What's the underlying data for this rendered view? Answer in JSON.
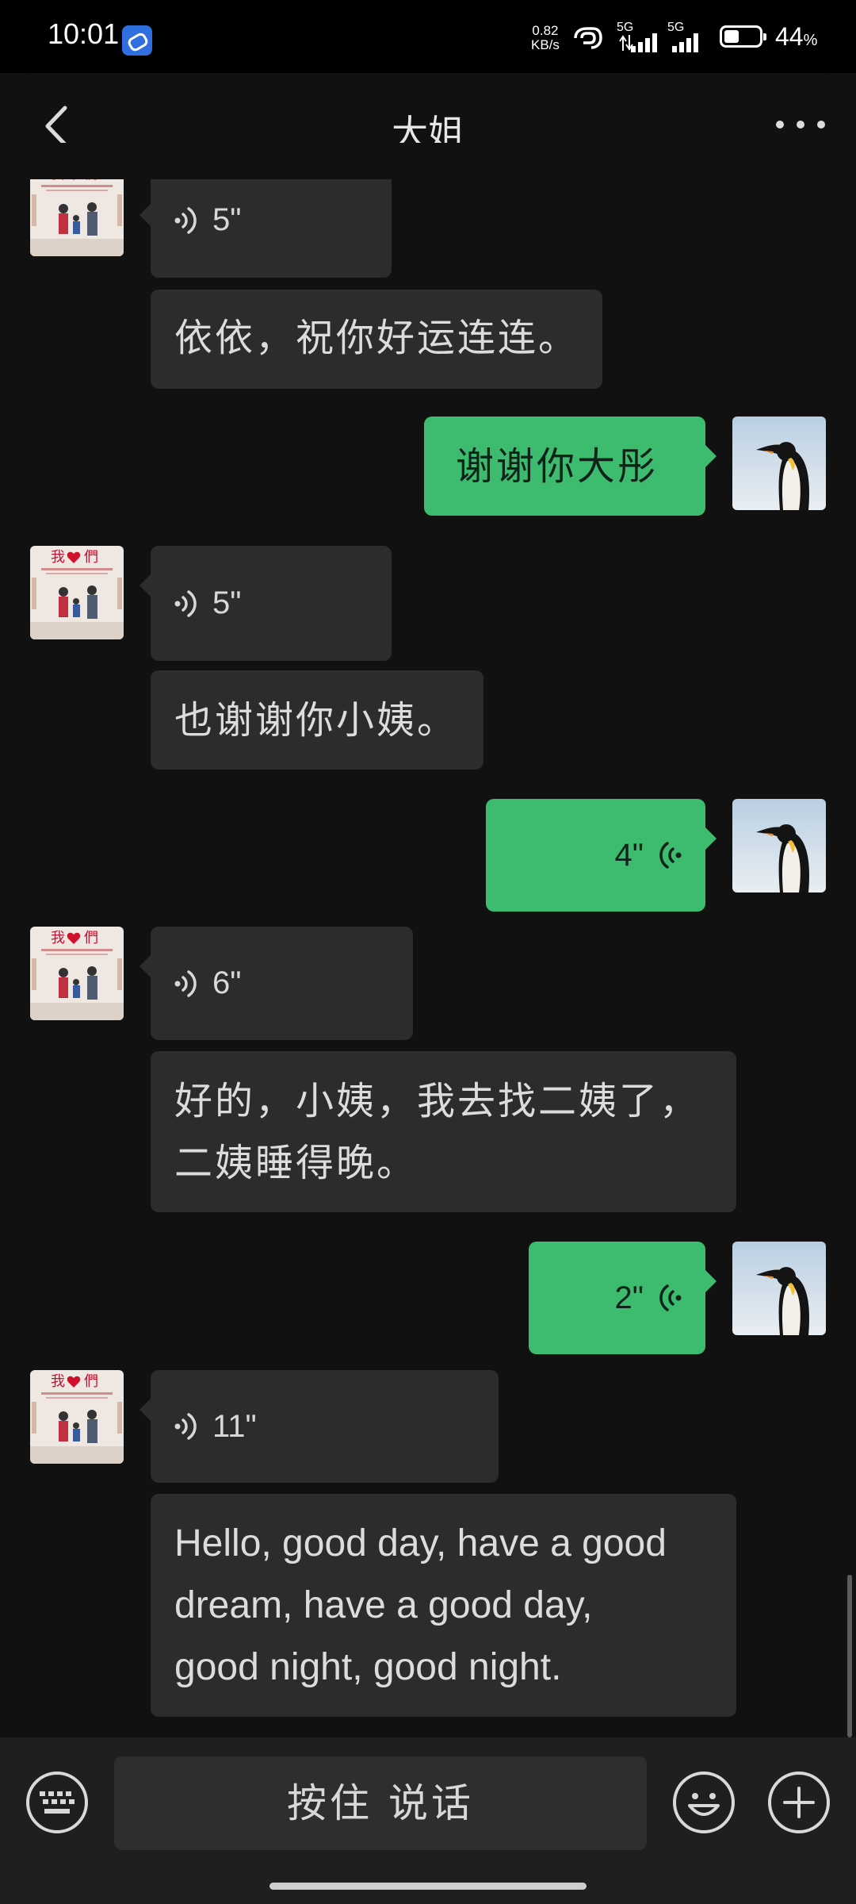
{
  "status_bar": {
    "time": "10:01",
    "net_speed_value": "0.82",
    "net_speed_unit": "KB/s",
    "sim1_network": "5G",
    "sim2_network": "5G",
    "battery_percent": "44",
    "battery_percent_suffix": "%",
    "battery_level": 0.44
  },
  "header": {
    "title": "大姐"
  },
  "messages": [
    {
      "side": "in",
      "type": "voice",
      "duration": "5\""
    },
    {
      "side": "in",
      "type": "text",
      "text": "依依，祝你好运连连。"
    },
    {
      "side": "out",
      "type": "text",
      "text": "谢谢你大彤"
    },
    {
      "side": "in",
      "type": "voice",
      "duration": "5\""
    },
    {
      "side": "in",
      "type": "text",
      "text": "也谢谢你小姨。"
    },
    {
      "side": "out",
      "type": "voice",
      "duration": "4\""
    },
    {
      "side": "in",
      "type": "voice",
      "duration": "6\""
    },
    {
      "side": "in",
      "type": "text",
      "lines": [
        "好的，小姨，我去找二姨了，",
        "二姨睡得晚。"
      ]
    },
    {
      "side": "out",
      "type": "voice",
      "duration": "2\""
    },
    {
      "side": "in",
      "type": "voice",
      "duration": "11\""
    },
    {
      "side": "in",
      "type": "text",
      "lines": [
        "Hello, good day, have a good",
        "dream, have a good day,",
        "good night, good night."
      ]
    }
  ],
  "contact_avatar": {
    "title_glyphs": "我❤們"
  },
  "bottom_bar": {
    "hold_to_talk": "按住 说话"
  },
  "icons": [
    "back-arrow-icon",
    "more-dots-icon",
    "voice-wave-icon",
    "keyboard-icon",
    "emoji-icon",
    "plus-icon",
    "hotspot-icon",
    "signal-icon",
    "battery-icon"
  ],
  "colors": {
    "background": "#111111",
    "incoming_bubble": "#2c2c2c",
    "outgoing_bubble": "#3dbb6f",
    "bottom_bar": "#1f1f1f"
  }
}
